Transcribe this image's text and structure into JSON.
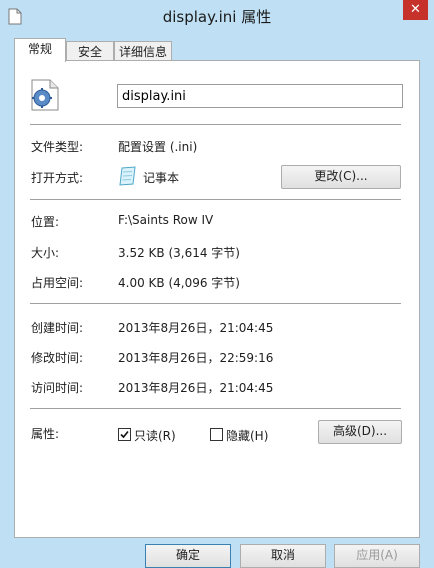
{
  "window": {
    "title": "display.ini 属性",
    "close_symbol": "✕"
  },
  "tabs": [
    {
      "label": "常规",
      "active": true
    },
    {
      "label": "安全",
      "active": false
    },
    {
      "label": "详细信息",
      "active": false
    }
  ],
  "file": {
    "icon": "ini-settings-file-icon",
    "name": "display.ini"
  },
  "type_info": {
    "type_label": "文件类型:",
    "type_value": "配置设置 (.ini)",
    "open_with_label": "打开方式:",
    "open_with_app_icon": "notepad-icon",
    "open_with_value": "记事本",
    "change_button": "更改(C)..."
  },
  "location_info": {
    "location_label": "位置:",
    "location_value": "F:\\Saints Row IV",
    "size_label": "大小:",
    "size_value": "3.52 KB (3,614 字节)",
    "disk_label": "占用空间:",
    "disk_value": "4.00 KB (4,096 字节)"
  },
  "time_info": {
    "created_label": "创建时间:",
    "created_value": "2013年8月26日，21:04:45",
    "modified_label": "修改时间:",
    "modified_value": "2013年8月26日，22:59:16",
    "accessed_label": "访问时间:",
    "accessed_value": "2013年8月26日，21:04:45"
  },
  "attributes": {
    "label": "属性:",
    "readonly_label": "只读(R)",
    "readonly_checked": true,
    "hidden_label": "隐藏(H)",
    "hidden_checked": false,
    "advanced_button": "高级(D)..."
  },
  "bottom_buttons": {
    "ok": "确定",
    "cancel": "取消",
    "apply": "应用(A)"
  },
  "colors": {
    "window_frame": "#bfe0f4",
    "close_button": "#c7312c"
  }
}
